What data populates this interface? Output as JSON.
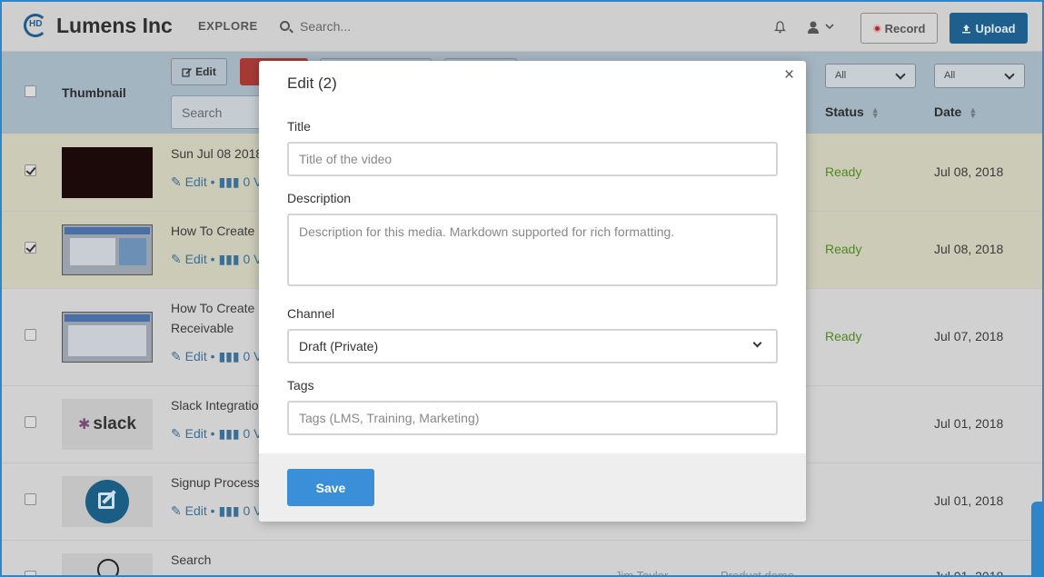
{
  "app": {
    "brand": "Lumens Inc",
    "logo_text": "HD"
  },
  "nav": {
    "explore": "EXPLORE",
    "search_placeholder": "Search...",
    "record": "Record",
    "upload": "Upload"
  },
  "toolbar": {
    "edit": "Edit",
    "search_placeholder": "Search",
    "filter_1": "All",
    "filter_2": "All"
  },
  "table": {
    "headers": {
      "thumbnail": "Thumbnail",
      "status": "Status",
      "date": "Date"
    },
    "action_edit": "Edit",
    "action_views": "0 Vi",
    "rows": [
      {
        "title_1": "Sun Jul 08 2018",
        "title_2": "",
        "status": "Ready",
        "date": "Jul 08, 2018",
        "checked": true
      },
      {
        "title_1": "How To Create",
        "title_2": "",
        "status": "Ready",
        "date": "Jul 08, 2018",
        "checked": true
      },
      {
        "title_1": "How To Create",
        "title_2": "Receivable",
        "status": "Ready",
        "date": "Jul 07, 2018",
        "checked": false
      },
      {
        "title_1": "Slack Integratio",
        "title_2": "",
        "status": "",
        "date": "Jul 01, 2018",
        "checked": false,
        "thumb_text": "slack"
      },
      {
        "title_1": "Signup Process",
        "title_2": "",
        "status": "",
        "date": "Jul 01, 2018",
        "checked": false
      },
      {
        "title_1": "Search",
        "title_2": "",
        "status": "",
        "date": "Jul 01, 2018",
        "checked": false,
        "owner": "Jim Taylor",
        "channel": "Product demo"
      }
    ]
  },
  "modal": {
    "title": "Edit (2)",
    "close": "×",
    "title_label": "Title",
    "title_placeholder": "Title of the video",
    "description_label": "Description",
    "description_placeholder": "Description for this media. Markdown supported for rich formatting.",
    "channel_label": "Channel",
    "channel_value": "Draft (Private)",
    "tags_label": "Tags",
    "tags_placeholder": "Tags (LMS, Training, Marketing)",
    "save": "Save"
  }
}
